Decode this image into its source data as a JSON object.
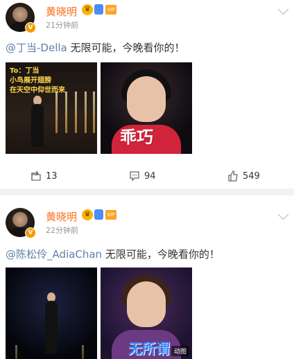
{
  "posts": [
    {
      "author": "黄晓明",
      "time": "21分钟前",
      "mention": "@丁当-Della",
      "text": " 无限可能，今晚看你的！",
      "image1_caption": "To：丁当\n小鸟展开翅膀\n在天空中仰世而来",
      "image2_caption": "乖巧",
      "reposts": "13",
      "comments": "94",
      "likes": "549"
    },
    {
      "author": "黄晓明",
      "time": "22分钟前",
      "mention": "@陈松伶_AdiaChan",
      "text": " 无限可能，今晚看你的！",
      "image2_caption": "无所谓",
      "image2_badge": "动图"
    }
  ],
  "icons": {
    "verified": "V",
    "crown": "crown-icon",
    "repost": "repost-icon",
    "comment": "comment-icon",
    "like": "thumbs-up-icon"
  },
  "colors": {
    "username": "#f86e1b",
    "mention": "#5e7fa8",
    "time": "#939393"
  }
}
